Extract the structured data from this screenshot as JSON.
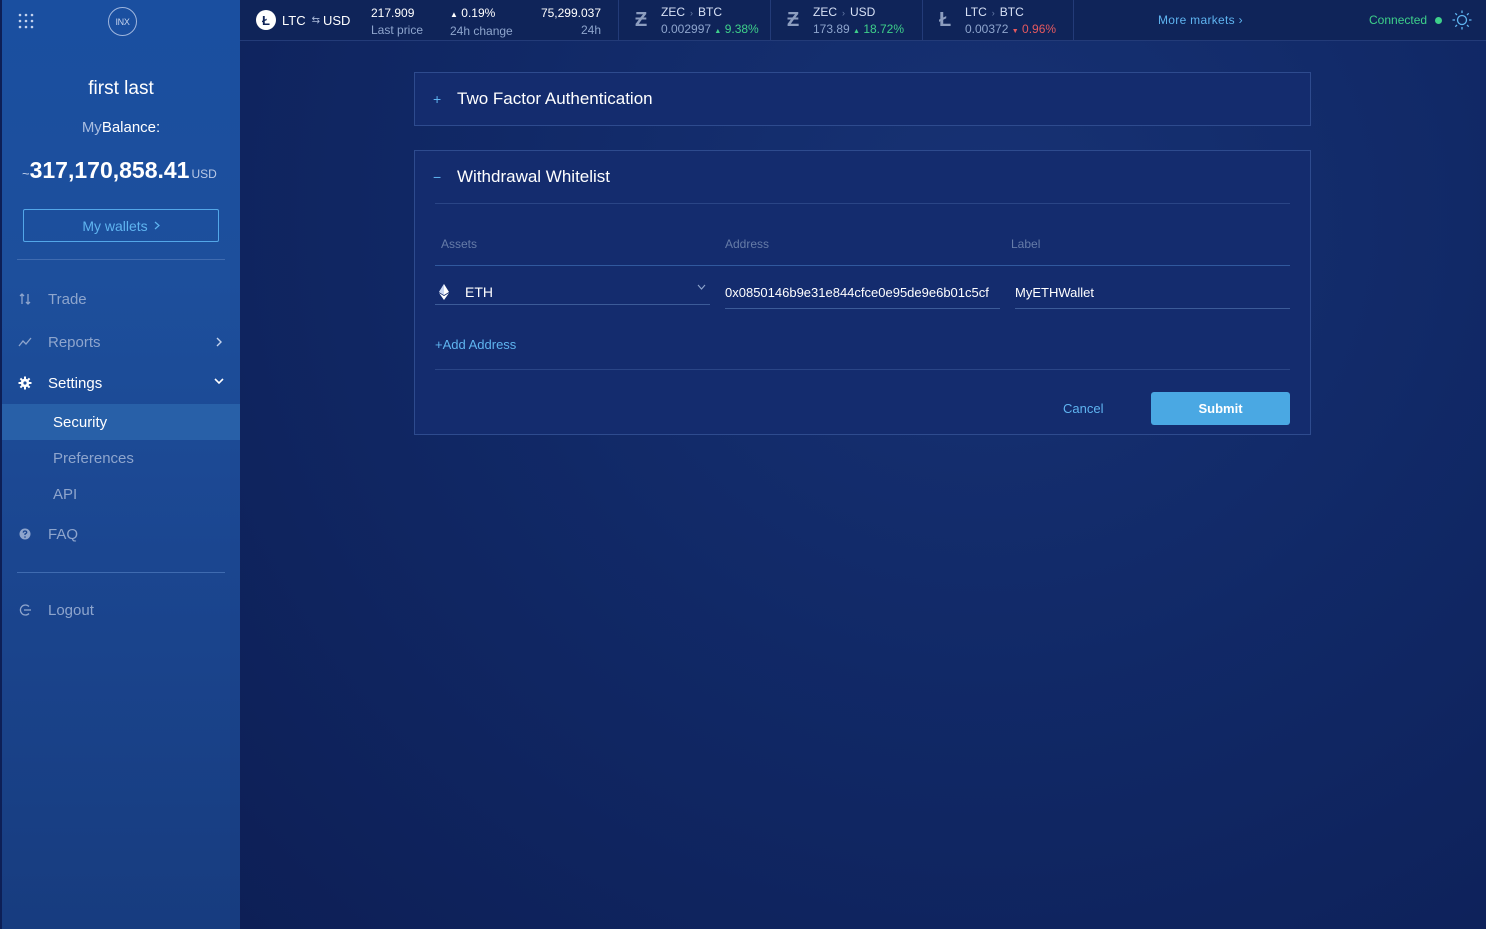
{
  "sidebar": {
    "logo_text": "INX",
    "user_name": "first last",
    "balance_label_prefix": "My",
    "balance_label_main": "Balance:",
    "balance_tilde": "~",
    "balance_amount": "317,170,858.41",
    "balance_currency": "USD",
    "wallets_button": "My wallets",
    "nav": {
      "trade": "Trade",
      "reports": "Reports",
      "settings": "Settings",
      "security": "Security",
      "preferences": "Preferences",
      "api": "API",
      "faq": "FAQ",
      "logout": "Logout"
    }
  },
  "topbar": {
    "main_pair": {
      "base": "LTC",
      "quote": "USD",
      "icon": "litecoin-icon"
    },
    "last_price": "217.909",
    "last_price_label": "Last price",
    "change": "0.19%",
    "change_label": "24h change",
    "volume": "75,299.037",
    "volume_label": "24h volume",
    "markets": [
      {
        "base": "ZEC",
        "quote": "BTC",
        "price": "0.002997",
        "change": "9.38%",
        "direction": "up",
        "icon": "zcash-icon"
      },
      {
        "base": "ZEC",
        "quote": "USD",
        "price": "173.89",
        "change": "18.72%",
        "direction": "up",
        "icon": "zcash-icon"
      },
      {
        "base": "LTC",
        "quote": "BTC",
        "price": "0.00372",
        "change": "0.96%",
        "direction": "down",
        "icon": "litecoin-icon"
      }
    ],
    "more_markets": "More markets",
    "status": "Connected"
  },
  "main": {
    "two_factor": {
      "toggle": "+",
      "title": "Two Factor Authentication"
    },
    "whitelist": {
      "toggle": "−",
      "title": "Withdrawal Whitelist",
      "columns": {
        "assets": "Assets",
        "address": "Address",
        "label": "Label"
      },
      "rows": [
        {
          "asset": "ETH",
          "address": "0x0850146b9e31e844cfce0e95de9e6b01c5cf",
          "label": "MyETHWallet"
        }
      ],
      "add_address": "+Add Address",
      "cancel": "Cancel",
      "submit": "Submit"
    }
  },
  "colors": {
    "accent": "#5fb4f0",
    "positive": "#3ed08a",
    "negative": "#e5595f",
    "submit": "#4aa8e3",
    "background": "#0d1f56"
  }
}
